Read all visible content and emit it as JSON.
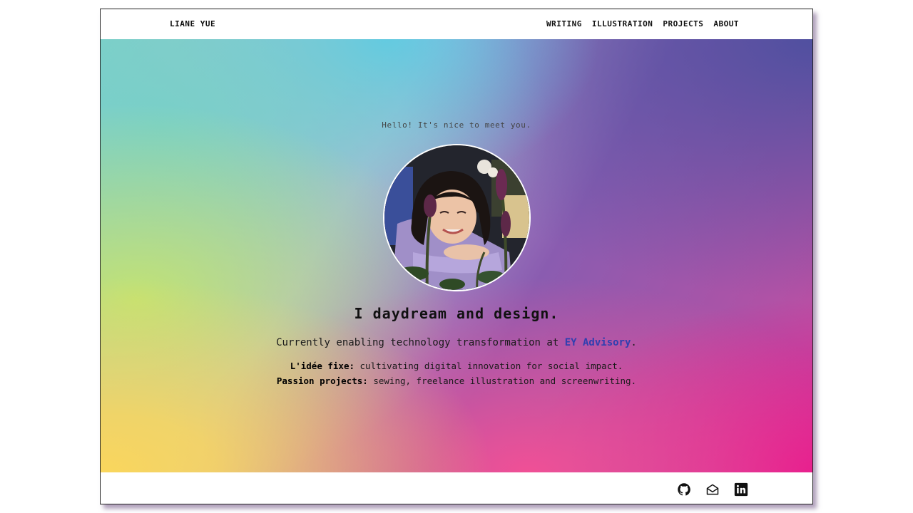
{
  "nav": {
    "brand": "LIANE YUE",
    "links": [
      "WRITING",
      "ILLUSTRATION",
      "PROJECTS",
      "ABOUT"
    ]
  },
  "hero": {
    "greeting": "Hello! It's nice to meet you.",
    "headline": "I daydream and design.",
    "current_prefix": "Currently enabling technology transformation at ",
    "current_link": "EY Advisory",
    "current_suffix": ".",
    "idee_label": "L'idée fixe:",
    "idee_text": " cultivating digital innovation for social impact.",
    "passion_label": "Passion projects:",
    "passion_text": " sewing, freelance illustration and screenwriting."
  },
  "footer": {
    "icons": [
      "github-icon",
      "mail-icon",
      "linkedin-icon"
    ]
  },
  "colors": {
    "link": "#2f3fb0",
    "gradient_stops": [
      "#7fcfca",
      "#fad65c",
      "#5ac8eb",
      "#5a5aa6",
      "#f05096",
      "#e6148c"
    ]
  }
}
